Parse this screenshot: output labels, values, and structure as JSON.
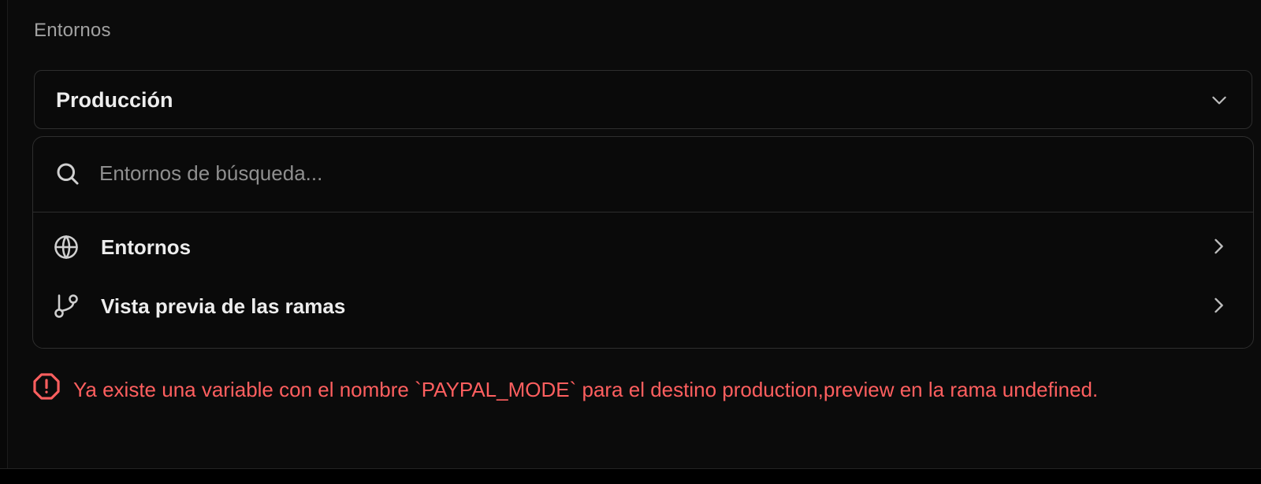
{
  "section": {
    "label": "Entornos"
  },
  "select": {
    "value": "Producción",
    "chevron_icon": "chevron-down-icon"
  },
  "search": {
    "placeholder": "Entornos de búsqueda...",
    "value": "",
    "icon": "search-icon"
  },
  "menu": {
    "items": [
      {
        "label": "Entornos",
        "icon": "globe-icon",
        "trailing_icon": "chevron-right-icon"
      },
      {
        "label": "Vista previa de las ramas",
        "icon": "git-branch-icon",
        "trailing_icon": "chevron-right-icon"
      }
    ]
  },
  "error": {
    "icon": "alert-octagon-icon",
    "message": "Ya existe una variable con el nombre `PAYPAL_MODE` para el destino production,preview en la rama undefined."
  },
  "colors": {
    "background": "#0a0a0a",
    "border": "#2e2e2e",
    "text_primary": "#ededed",
    "text_muted": "#a1a1a1",
    "error": "#ff5f5f"
  }
}
